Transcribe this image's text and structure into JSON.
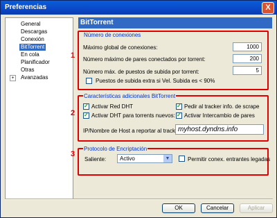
{
  "window": {
    "title": "Preferencias",
    "close_symbol": "X"
  },
  "tree": {
    "items": [
      {
        "label": "General",
        "selected": false
      },
      {
        "label": "Descargas",
        "selected": false
      },
      {
        "label": "Conexión",
        "selected": false
      },
      {
        "label": "BitTorrent",
        "selected": true
      },
      {
        "label": "En cola",
        "selected": false
      },
      {
        "label": "Planificador",
        "selected": false
      },
      {
        "label": "Otras",
        "selected": false
      },
      {
        "label": "Avanzadas",
        "selected": false,
        "expander": "+"
      }
    ]
  },
  "panel": {
    "title": "BitTorrent"
  },
  "markers": [
    "1",
    "2",
    "3"
  ],
  "connections": {
    "legend": "Número de conexiones",
    "global_max_label": "Máximo global de conexiones:",
    "global_max_value": "1000",
    "peers_label": "Número máximo de pares conectados por torrent:",
    "peers_value": "200",
    "upload_slots_label": "Número máx. de puestos de subida por torrent:",
    "upload_slots_value": "5",
    "extra_slots_label": "Puestos de subida extra si Vel. Subida es < 90%",
    "extra_slots_checked": false
  },
  "features": {
    "legend": "Características adicionales BitTorrent",
    "dht_label": "Activar Red DHT",
    "dht_checked": true,
    "scrape_label": "Pedir al tracker info. de scrape",
    "scrape_checked": true,
    "dht_new_label": "Activar DHT para torrents nuevos:",
    "dht_new_checked": true,
    "pex_label": "Activar Intercambio de pares",
    "pex_checked": true,
    "host_label": "IP/Nombre de Host a reportar al tracker:",
    "host_value": "myhost.dyndns.info"
  },
  "encryption": {
    "legend": "Protocolo de Encriptación",
    "outgoing_label": "Saliente:",
    "outgoing_value": "Activo",
    "legacy_label": "Permitir conex. entrantes legadas",
    "legacy_checked": false
  },
  "buttons": {
    "ok": "OK",
    "cancel": "Cancelar",
    "apply": "Aplicar"
  }
}
